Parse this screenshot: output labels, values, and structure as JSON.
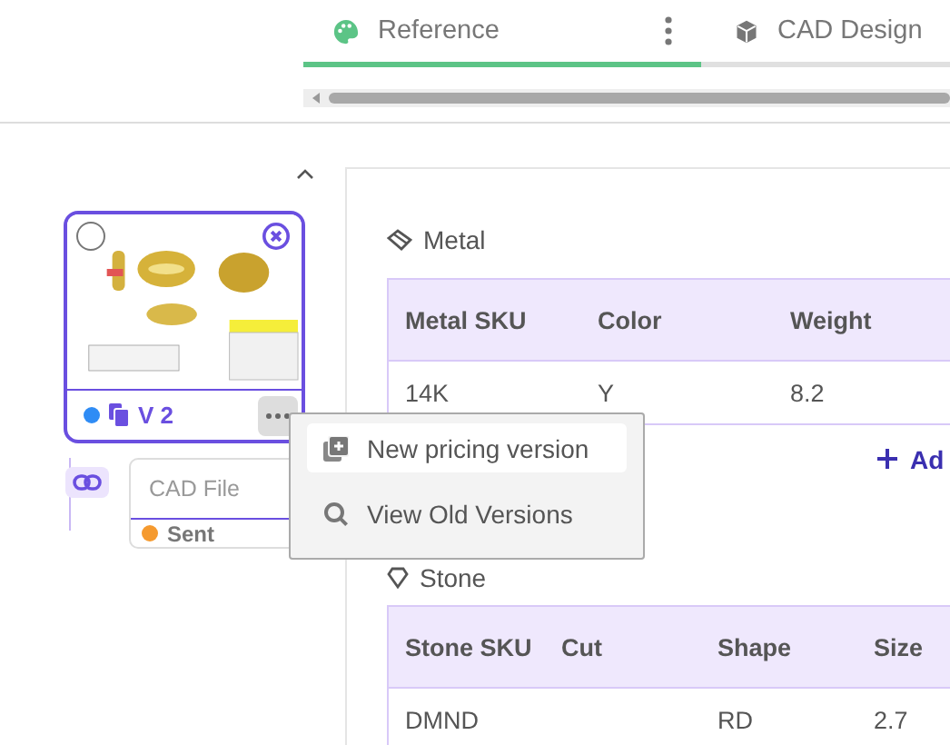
{
  "tabs": [
    {
      "label": "Reference",
      "selected": true
    },
    {
      "label": "CAD Design",
      "selected": false
    }
  ],
  "version_card": {
    "selected": false,
    "version": "V 2"
  },
  "cad_file": {
    "label": "CAD File",
    "status": "Sent"
  },
  "menu": {
    "items": [
      {
        "label": "New pricing version",
        "selected": true
      },
      {
        "label": "View Old Versions",
        "selected": false
      }
    ]
  },
  "sections": [
    {
      "title": "Metal",
      "columns": [
        "Metal SKU",
        "Color",
        "Weight"
      ],
      "rows": [
        [
          "14K",
          "Y",
          "8.2"
        ]
      ],
      "add_label": "Ad"
    },
    {
      "title": "Stone",
      "columns": [
        "Stone SKU",
        "Cut",
        "Shape",
        "Size"
      ],
      "rows": [
        [
          "DMND",
          "",
          "RD",
          "2.7"
        ]
      ]
    }
  ]
}
